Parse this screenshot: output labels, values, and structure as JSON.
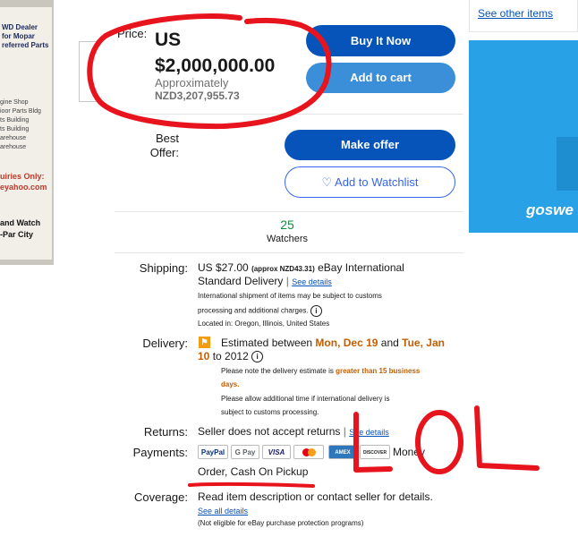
{
  "photo": {
    "lines": [
      "WD Dealer",
      "for Mopar",
      "referred Parts"
    ],
    "small_lines": [
      "gine Shop",
      "ioor Parts Bldg",
      "ts Building",
      "ts Building",
      "arehouse",
      "arehouse"
    ],
    "red_lines": [
      "uiries Only:",
      "eyahoo.com"
    ],
    "black_lines": [
      "and Watch",
      "-Par City"
    ],
    "thumb_arrow": "›"
  },
  "price": {
    "label": "Price:",
    "currency": "US",
    "amount": "$2,000,000.00",
    "approx_label": "Approximately",
    "approx_value": "NZD3,207,955.73"
  },
  "buttons": {
    "buy_now": "Buy It Now",
    "add_to_cart": "Add to cart",
    "make_offer": "Make offer",
    "watchlist": "Add to Watchlist",
    "heart_glyph": "♡"
  },
  "best_offer_label": "Best Offer:",
  "watchers": {
    "count": "25",
    "label": "Watchers"
  },
  "sidebar": {
    "see_other_items": "See other items",
    "ad_text": "goswe"
  },
  "shipping": {
    "label": "Shipping:",
    "cost": "US $27.00",
    "approx": "(approx NZD43.31)",
    "method_a": "eBay International",
    "method_b": "Standard Delivery",
    "sep": "|",
    "details_link": "See details",
    "note_a": "International shipment of items may be subject to customs",
    "note_b": "processing and additional charges.",
    "located": "Located in: Oregon, Illinois, United States"
  },
  "delivery": {
    "label": "Delivery:",
    "est_prefix": "Estimated between",
    "date_start": "Mon, Dec 19",
    "and": "and",
    "date_end_a": "Tue, Jan",
    "date_end_b": "10",
    "to_year": "to 2012",
    "note_prefix": "Please note the delivery estimate is",
    "note_highlight": "greater than 15 business",
    "note_highlight_b": "days.",
    "allow_a": "Please allow additional time if international delivery is",
    "allow_b": "subject to customs processing."
  },
  "returns": {
    "label": "Returns:",
    "text": "Seller does not accept returns",
    "sep": "|",
    "link": "See details"
  },
  "payments": {
    "label": "Payments:",
    "logos": [
      "PayPal",
      "G Pay",
      "VISA",
      "",
      "AMEX",
      "DISCOVER"
    ],
    "money_order_a": "Money",
    "money_order_b": "Order, Cash On Pickup"
  },
  "coverage": {
    "label": "Coverage:",
    "text": "Read item description or contact seller for details.",
    "link": "See all details",
    "note": "(Not eligible for eBay purchase protection programs)"
  },
  "annotation": {
    "text": "LOL",
    "color": "#e8141d"
  }
}
